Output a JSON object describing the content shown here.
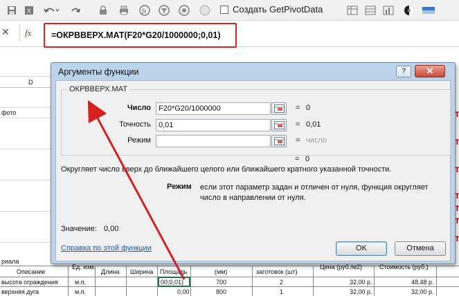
{
  "toolbar": {
    "icons": [
      "save-icon",
      "excel-icon",
      "undo-icon",
      "redo-icon",
      "lock-icon",
      "print-icon",
      "sort-icon",
      "filter-icon",
      "dot-icon",
      "insert-icon",
      "shape-icon",
      "contrast-icon",
      "flag-icon"
    ],
    "getpivot_label": "Создать GetPivotData"
  },
  "formula_bar": {
    "cancel_symbol": "✕",
    "fx_label": "fx",
    "formula": "=ОКРВВЕРХ.МАТ(F20*G20/1000000;0,01)"
  },
  "sheet": {
    "col_d": "D",
    "foto": "фото",
    "material": "риала",
    "headers": [
      "Описание",
      "Ед. изм.",
      "Длина",
      "Ширина",
      "Площадь",
      "(мм)",
      "заготовок (шт)",
      "Цена (руб./м2)",
      "Стоимость (руб.)"
    ],
    "rows": [
      {
        "desc": "высота ограждения",
        "unit": "м.п.",
        "area": "00;0,01)",
        "mm": "700",
        "qty": "2",
        "price": "32,00 р.",
        "cost": "48,48 р."
      },
      {
        "desc": "верхняя дуга",
        "unit": "м.п.",
        "area": "0,00",
        "mm": "800",
        "qty": "1",
        "price": "32,00 р.",
        "cost": "32,00 р."
      }
    ],
    "right_marks": [
      "Т",
      "Т",
      "Т",
      "Т",
      "Т",
      "Т",
      "Т"
    ]
  },
  "dialog": {
    "title": "Аргументы функции",
    "help_btn": "?",
    "close_btn": "✕",
    "function_name": "ОКРВВЕРХ.МАТ",
    "args": [
      {
        "label": "Число",
        "value": "F20*G20/1000000",
        "eq": "=",
        "result": "0",
        "bold": true
      },
      {
        "label": "Точность",
        "value": "0,01",
        "eq": "=",
        "result": "0,01",
        "bold": false
      },
      {
        "label": "Режим",
        "value": "",
        "eq": "=",
        "result": "число",
        "bold": false
      }
    ],
    "total_eq": "=",
    "total_result": "0",
    "description": "Округляет число вверх до ближайшего целого или ближайшего кратного указанной точности.",
    "param_title": "Режим",
    "param_desc": "если этот параметр задан и отличен от нуля, функция округляет число в направлении от нуля.",
    "result_label": "Значение:",
    "result_value": "0,00",
    "help_link": "Справка по этой функции",
    "ok": "OK",
    "cancel": "Отмена"
  },
  "colors": {
    "highlight": "#e02020",
    "arrow": "#d62020",
    "dialog_frame": "#bcd3ea",
    "link": "#1f55b5"
  }
}
